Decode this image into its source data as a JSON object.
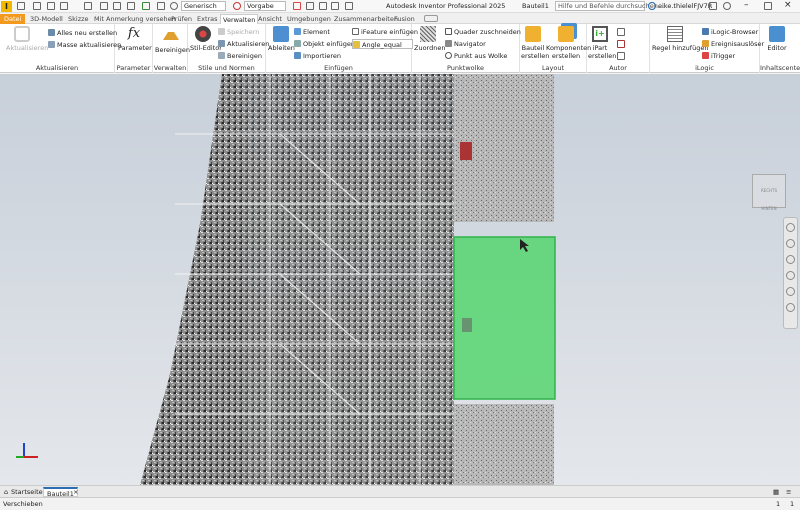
{
  "qat": {
    "logo": "I",
    "appearance": "Generisch",
    "material": "Vorgabe",
    "title": "Autodesk Inventor Professional 2025",
    "doc": "Bauteil1",
    "search_placeholder": "Hilfe und Befehle durchsuchen...",
    "user": "eike.thielelFJV7R"
  },
  "tabs": [
    "Datei",
    "3D-Modell",
    "Skizze",
    "Mit Anmerkung versehen",
    "Prüfen",
    "Extras",
    "Verwalten",
    "Ansicht",
    "Umgebungen",
    "Zusammenarbeiten",
    "Fusion"
  ],
  "active_tab": "Verwalten",
  "ribbon": {
    "aktualisieren": {
      "label": "Aktualisieren",
      "big": "Aktualisieren",
      "items": [
        "Alles neu erstellen",
        "Masse aktualisieren"
      ]
    },
    "parameter": {
      "label": "Parameter",
      "big": "Parameter"
    },
    "verwalten": {
      "label": "Verwalten",
      "big": "Bereinigen"
    },
    "stile": {
      "label": "Stile und Normen",
      "big": "Stil-Editor",
      "items": [
        "Speichern",
        "Aktualisieren",
        "Bereinigen"
      ]
    },
    "einfuegen": {
      "label": "Einfügen",
      "big": "Ableiten",
      "items": [
        "Element",
        "Objekt einfügen",
        "Importieren",
        "iFeature einfügen",
        "Angle_equal"
      ]
    },
    "punktwolke": {
      "label": "Punktwolke",
      "big": "Zuordnen",
      "items": [
        "Quader zuschneiden",
        "Navigator",
        "Punkt aus Wolke"
      ]
    },
    "layout": {
      "label": "Layout",
      "big1": "Bauteil erstellen",
      "big2": "Komponenten erstellen"
    },
    "autor": {
      "label": "Autor",
      "big": "iPart erstellen"
    },
    "ilogic": {
      "label": "iLogic",
      "big": "Regel hinzufügen",
      "items": [
        "iLogic-Browser",
        "Ereignisauslöser",
        "iTrigger"
      ]
    },
    "inhaltscenter": {
      "label": "Inhaltscenter",
      "big": "Editor"
    }
  },
  "viewcube": {
    "left": "RECHTS",
    "right": "HINTEN"
  },
  "doc_tabs": [
    "Startseite",
    "Bauteil1"
  ],
  "status": {
    "text": "Verschieben",
    "n1": "1",
    "n2": "1"
  },
  "colors": {
    "file_tab": "#f39a1e",
    "selection": "#3fd45a",
    "viewport_top": "#c7cfd9",
    "viewport_bottom": "#e4e7eb"
  }
}
